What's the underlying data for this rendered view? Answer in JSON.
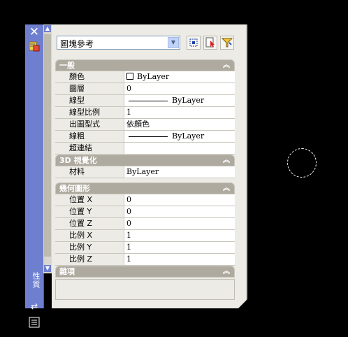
{
  "palette": {
    "title": "性質",
    "combo_value": "圖塊參考"
  },
  "sections": {
    "general": {
      "title": "一般",
      "rows": [
        {
          "key": "顏色",
          "value": "ByLayer"
        },
        {
          "key": "圖層",
          "value": "0"
        },
        {
          "key": "線型",
          "value": "ByLayer"
        },
        {
          "key": "線型比例",
          "value": "1"
        },
        {
          "key": "出圖型式",
          "value": "依顏色"
        },
        {
          "key": "線粗",
          "value": "ByLayer"
        },
        {
          "key": "超連結",
          "value": ""
        }
      ]
    },
    "visual3d": {
      "title": "3D 視覺化",
      "rows": [
        {
          "key": "材料",
          "value": "ByLayer"
        }
      ]
    },
    "geometry": {
      "title": "幾何圖形",
      "rows": [
        {
          "key": "位置 X",
          "value": "0"
        },
        {
          "key": "位置 Y",
          "value": "0"
        },
        {
          "key": "位置 Z",
          "value": "0"
        },
        {
          "key": "比例 X",
          "value": "1"
        },
        {
          "key": "比例 Y",
          "value": "1"
        },
        {
          "key": "比例 Z",
          "value": "1"
        }
      ]
    },
    "misc": {
      "title": "雜項"
    }
  },
  "colors": {
    "palette_strip": "#6f7fd0",
    "section_header": "#aeaaa0",
    "panel_bg": "#ecebe5"
  }
}
